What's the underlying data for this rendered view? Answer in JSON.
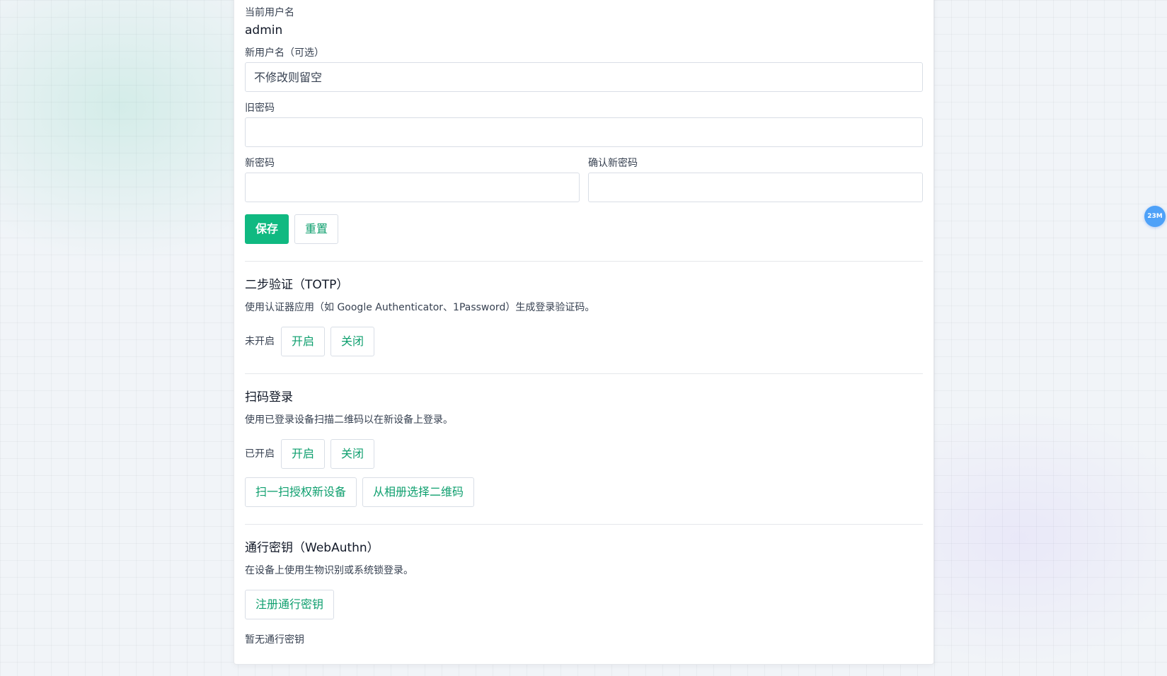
{
  "account": {
    "current_username_label": "当前用户名",
    "current_username": "admin",
    "new_username_label": "新用户名（可选）",
    "new_username_placeholder": "不修改则留空",
    "old_password_label": "旧密码",
    "new_password_label": "新密码",
    "confirm_password_label": "确认新密码",
    "save_label": "保存",
    "reset_label": "重置"
  },
  "totp": {
    "title": "二步验证（TOTP）",
    "description": "使用认证器应用（如 Google Authenticator、1Password）生成登录验证码。",
    "status": "未开启",
    "enable_label": "开启",
    "disable_label": "关闭"
  },
  "qr_login": {
    "title": "扫码登录",
    "description": "使用已登录设备扫描二维码以在新设备上登录。",
    "status": "已开启",
    "enable_label": "开启",
    "disable_label": "关闭",
    "scan_label": "扫一扫授权新设备",
    "album_label": "从相册选择二维码"
  },
  "passkey": {
    "title": "通行密钥（WebAuthn）",
    "description": "在设备上使用生物识别或系统锁登录。",
    "register_label": "注册通行密钥",
    "empty_text": "暂无通行密钥"
  },
  "floating_badge": {
    "text": "23M",
    "color": "#4ea1f8"
  },
  "colors": {
    "accent": "#10b981",
    "accent_text": "#0e9f6e"
  }
}
